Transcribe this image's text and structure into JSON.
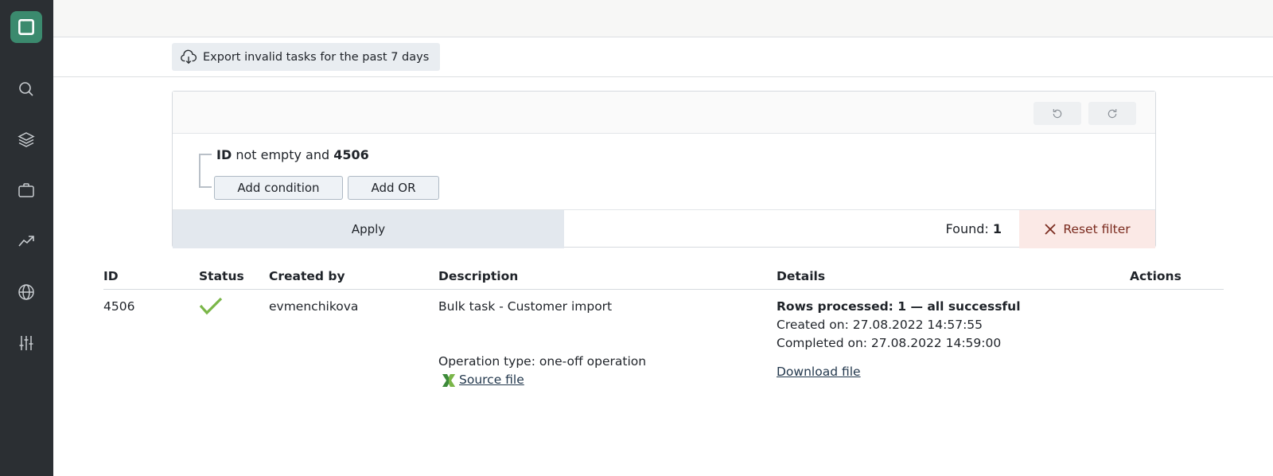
{
  "export": {
    "label": "Export invalid tasks for the past 7 days"
  },
  "filter": {
    "condition": {
      "field": "ID",
      "operator": "not empty and",
      "value": "4506"
    },
    "add_condition_label": "Add condition",
    "add_or_label": "Add OR",
    "apply_label": "Apply",
    "found_label": "Found:",
    "found_count": "1",
    "reset_label": "Reset filter"
  },
  "table": {
    "headers": [
      "ID",
      "Status",
      "Created by",
      "Description",
      "Details",
      "Actions"
    ],
    "rows": [
      {
        "id": "4506",
        "status": "success",
        "created_by": "evmenchikova",
        "description": "Bulk task - Customer import",
        "operation_type": "Operation type: one-off operation",
        "source_file_label": "Source file",
        "rows_processed": "Rows processed: 1 — all successful",
        "created_on": "Created on: 27.08.2022 14:57:55",
        "completed_on": "Completed on: 27.08.2022 14:59:00",
        "download_label": "Download file"
      }
    ]
  },
  "colors": {
    "sidebar": "#2b2f33",
    "logo": "#3b8a6e",
    "success": "#7ab648",
    "reset_text": "#7a2a1e"
  }
}
